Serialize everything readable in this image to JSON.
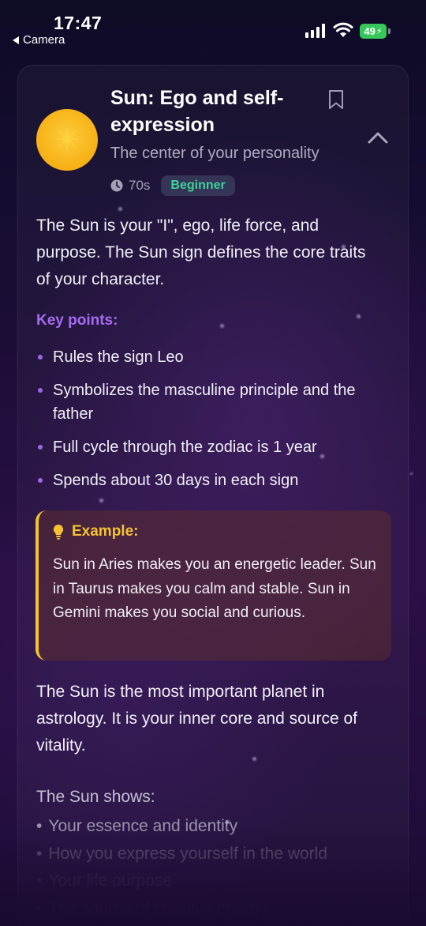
{
  "status_bar": {
    "time": "17:47",
    "back_label": "Camera",
    "battery": "49"
  },
  "lesson": {
    "title": "Sun: Ego and self-expression",
    "subtitle": "The center of your personality",
    "duration": "70s",
    "level": "Beginner",
    "sun_icon": "☀",
    "intro": "The Sun is your \"I\", ego, life force, and purpose. The Sun sign defines the core traits of your character.",
    "key_points_title": "Key points:",
    "key_points": [
      "Rules the sign Leo",
      "Symbolizes the masculine principle and the father",
      "Full cycle through the zodiac is 1 year",
      "Spends about 30 days in each sign"
    ],
    "example": {
      "title": "Example:",
      "text": "Sun in Aries makes you an energetic leader. Sun in Taurus makes you calm and stable. Sun in Gemini makes you social and curious."
    },
    "body": "The Sun is the most important planet in astrology. It is your inner core and source of vitality.",
    "shows_title": "The Sun shows:",
    "shows_items": [
      "Your essence and identity",
      "How you express yourself in the world",
      "Your life purpose",
      "The source of creative energy"
    ]
  },
  "colors": {
    "accent_purple": "#a46bf0",
    "beginner_green": "#3cd39a",
    "example_yellow": "#f5c230",
    "sun_orange": "#f7b014",
    "battery_green": "#35c759"
  },
  "icons": {
    "sun": "sun-icon",
    "bookmark": "bookmark-icon",
    "collapse": "chevron-up-icon",
    "clock": "clock-icon",
    "bulb": "lightbulb-icon"
  }
}
